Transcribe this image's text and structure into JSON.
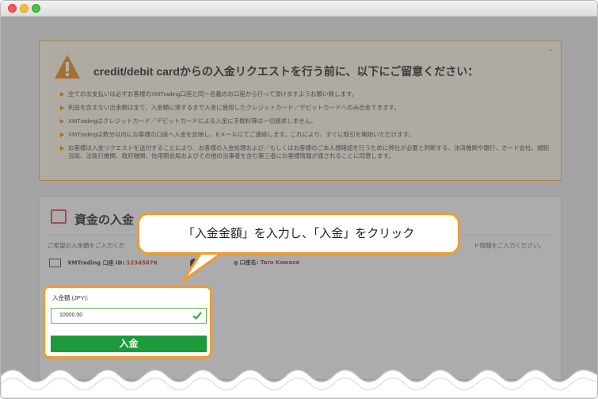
{
  "warning": {
    "title": "credit/debit cardからの入金リクエストを行う前に、以下にご留意ください：",
    "collapse_label": "–",
    "items": [
      "全てのお支払いは必ずお客様のXMTrading口座と同一名義のお口座から行って頂けますようお願い致します。",
      "利益を含まない出金額は全て、入金額に達するまで入金に使用したクレジットカード／デビットカードへのみ出金できます。",
      "XMTradingはクレジットカード／デビットカードによる入金に手数料等は一切請求しません。",
      "XMTradingは数分以内にお客様の口座へ入金を反映し、Eメールにてご連絡します。これにより、すぐに取引を開始いただけます。",
      "お客様は入金リクエストを送付することにより、お客様の入金処理および／もしくはお客様のご本人様確認を行うために弊社が必要と判断する、決済機関や銀行、カード会社、規制当局、法執行機関、政府機関、信用照会局およびその他の当事者を含む第三者にお客様情報が渡されることに同意します。"
    ]
  },
  "deposit": {
    "title": "資金の入金",
    "instruction_left": "ご希望の入金額をご入力くだ",
    "instruction_right": "ド情報をご入力ください。",
    "account_label": "XMTrading 口座 ID:",
    "account_id": "12345678",
    "name_label": "g 口座名:",
    "name_value": "Taro Kawase",
    "amount_label": "入金額 (JPY):",
    "amount_value": "10000.00",
    "submit_label": "入金"
  },
  "callout": {
    "text": "「入金金額」を入力し、「入金」をクリック"
  },
  "colors": {
    "accent": "#f19b2c",
    "button": "#1d9b3c",
    "account_id": "#c0392b"
  }
}
